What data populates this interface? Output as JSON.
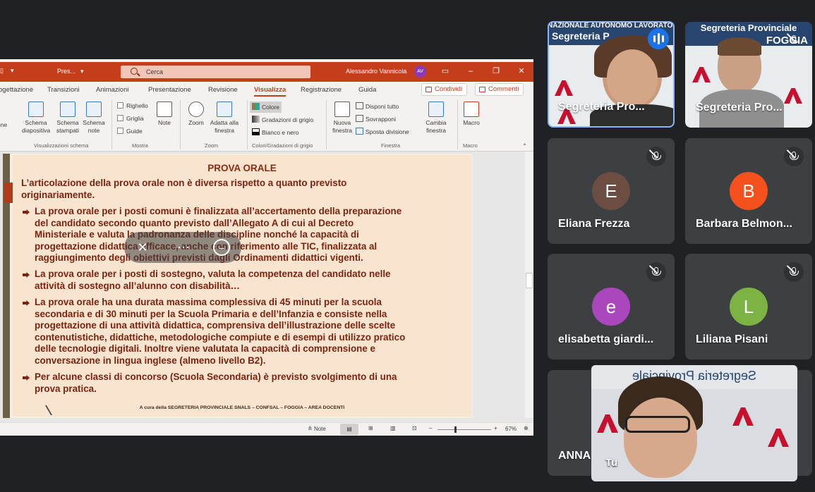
{
  "ppt": {
    "file_name": "Pres...",
    "search_placeholder": "Cerca",
    "user_name": "Alessandro Vannicola",
    "user_initials": "AV",
    "tabs": [
      "ogettazione",
      "Transizioni",
      "Animazioni",
      "Presentazione",
      "Revisione",
      "Visualizza",
      "Registrazione",
      "Guida"
    ],
    "active_tab": "Visualizza",
    "share_label": "Condividi",
    "comments_label": "Commenti",
    "ribbon": {
      "partial": "one",
      "schema_diapositiva": "Schema diapositiva",
      "schema_stampati": "Schema stampati",
      "schema_note": "Schema note",
      "righello": "Righello",
      "griglia": "Griglia",
      "guide": "Guide",
      "note": "Note",
      "zoom": "Zoom",
      "adatta": "Adatta alla finestra",
      "colore": "Colore",
      "gradazioni": "Gradazioni di grigio",
      "bianco_nero": "Bianco e nero",
      "nuova_finestra": "Nuova finestra",
      "disponi": "Disponi tutto",
      "sovrapponi": "Sovrapponi",
      "sposta": "Sposta divisione",
      "cambia": "Cambia finestra",
      "macro": "Macro",
      "group_viz": "Visualizzazioni schema",
      "group_mostra": "Mostra",
      "group_zoom": "Zoom",
      "group_colori": "Colori/Gradazioni di grigio",
      "group_finestra": "Finestra",
      "group_macro": "Macro"
    },
    "status": {
      "note": "Note",
      "zoom_pct": "67%"
    }
  },
  "slide": {
    "title": "PROVA ORALE",
    "intro_1": "L’articolazione della prova orale non è diversa rispetto a quanto previsto",
    "intro_2": "originariamente.",
    "b1": [
      "La prova orale per i posti comuni è finalizzata all’accertamento della preparazione",
      "del candidato secondo quanto previsto dall’Allegato A di cui al  Decreto",
      "Ministeriale e valuta la padronanza delle discipline nonché la capacità di",
      "progettazione didattica efficace, anche con riferimento alle TIC, finalizzata al",
      "raggiungimento degli obiettivi previsti dagli Ordinamenti didattici vigenti."
    ],
    "b2": [
      "La prova orale per i posti di sostegno, valuta la competenza del candidato nelle",
      "attività di sostegno all’alunno con disabilità…"
    ],
    "b3": [
      "La prova orale ha una durata massima complessiva di 45 minuti per la scuola",
      "secondaria e di 30 minuti per la Scuola Primaria e dell’Infanzia e consiste nella",
      "progettazione di una attività didattica, comprensiva dell’illustrazione delle scelte",
      "contenutistiche, didattiche, metodologiche compiute e di esempi di utilizzo pratico",
      "delle tecnologie digitali. Inoltre viene valutata la capacità di comprensione e",
      "conversazione in lingua inglese (almeno livello B2)."
    ],
    "b4": [
      "Per alcune classi di concorso (Scuola Secondaria) è previsto svolgimento di una",
      "prova pratica."
    ],
    "footer": "A cura della SEGRETERIA PROVINCIALE SNALS – CONFSAL – FOGGIA – AREA DOCENTI"
  },
  "meet": {
    "tiles": [
      {
        "name": "Segreteria Pro...",
        "banner_1": "NAZIONALE AUTONOMO LAVORATORI",
        "banner_2": "Segreteria P"
      },
      {
        "name": "Segreteria Pro...",
        "banner_1": "Segreteria Provinciale",
        "banner_2": "FOGGIA"
      },
      {
        "name": "Eliana Frezza",
        "initial": "E",
        "color": "#6d4c41"
      },
      {
        "name": "Barbara Belmon...",
        "initial": "B",
        "color": "#f4511e"
      },
      {
        "name": "elisabetta giardi...",
        "initial": "e",
        "color": "#ab47bc"
      },
      {
        "name": "Liliana Pisani",
        "initial": "L",
        "color": "#7cb342"
      },
      {
        "name": "ANNA"
      }
    ],
    "self_label": "Tu",
    "self_banner": "Segreteria Provinciale"
  }
}
